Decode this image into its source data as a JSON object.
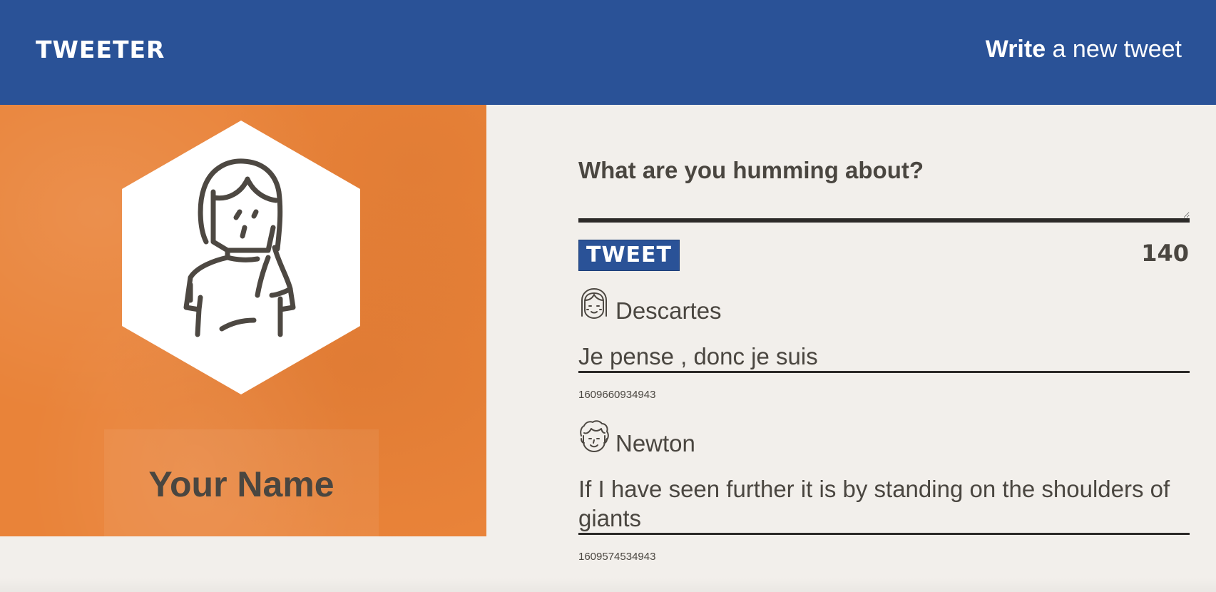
{
  "header": {
    "logo": "TWEETER",
    "action_strong": "Write",
    "action_rest": " a new tweet"
  },
  "profile": {
    "name": "Your Name"
  },
  "compose": {
    "placeholder": "What are you humming about?",
    "button_label": "TWEET",
    "counter": "140"
  },
  "tweets": [
    {
      "author": "Descartes",
      "avatar_icon": "girl-face-icon",
      "content": "Je pense , donc je suis",
      "timestamp": "1609660934943"
    },
    {
      "author": "Newton",
      "avatar_icon": "curly-hair-man-face-icon",
      "content": "If I have seen further it is by standing on the shoulders of giants",
      "timestamp": "1609574534943"
    }
  ],
  "colors": {
    "header_blue": "#2a5297",
    "profile_orange": "#e98339",
    "page_bg": "#f2efeb",
    "text_dark": "#4a4640"
  }
}
